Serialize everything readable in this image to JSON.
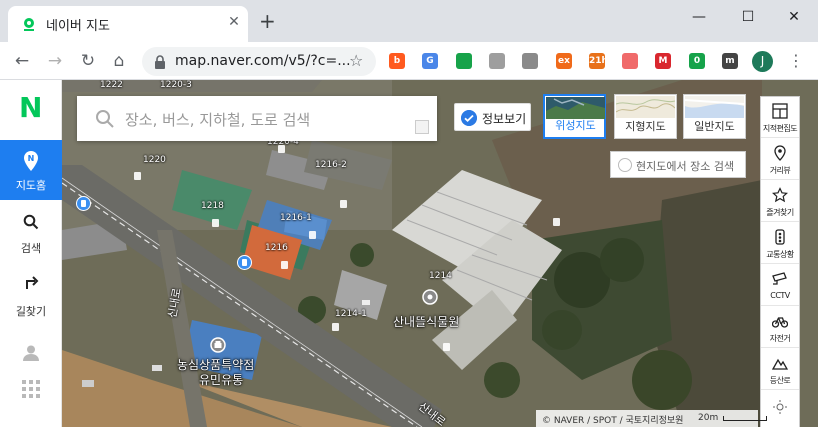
{
  "browser": {
    "tab_title": "네이버 지도",
    "tab_close": "✕",
    "new_tab": "+",
    "window_min": "—",
    "window_max": "☐",
    "window_close": "✕",
    "url": "map.naver.com/v5/?c=...",
    "profile_initial": "J",
    "extensions": [
      {
        "name": "b-icon",
        "color": "#ff5a1f",
        "text": "b"
      },
      {
        "name": "translate-icon",
        "color": "#4a86e8",
        "text": "G"
      },
      {
        "name": "screenshot-icon",
        "color": "#17a34a",
        "text": ""
      },
      {
        "name": "tag-icon",
        "color": "#9e9e9e",
        "text": ""
      },
      {
        "name": "dropbox-icon",
        "color": "#8a8a8a",
        "text": ""
      },
      {
        "name": "ex-icon",
        "color": "#f06a1a",
        "text": "ex"
      },
      {
        "name": "calendar-icon",
        "color": "#e8711a",
        "text": "21h"
      },
      {
        "name": "asana-icon",
        "color": "#f06a6a",
        "text": ""
      },
      {
        "name": "mega-icon",
        "color": "#d9272e",
        "text": "M"
      },
      {
        "name": "shield-check-icon",
        "color": "#16a34a",
        "text": "0"
      },
      {
        "name": "m-icon",
        "color": "#444444",
        "text": "m"
      }
    ]
  },
  "sidebar": {
    "logo": "N",
    "items": [
      {
        "label": "지도홈"
      },
      {
        "label": "검색"
      },
      {
        "label": "길찾기"
      }
    ]
  },
  "search": {
    "placeholder": "장소, 버스, 지하철, 도로 검색"
  },
  "info_toggle": "정보보기",
  "map_types": [
    {
      "label": "위성지도"
    },
    {
      "label": "지형지도"
    },
    {
      "label": "일반지도"
    }
  ],
  "area_search": "현지도에서 장소 검색",
  "right_tools": [
    {
      "label": "지적편집도",
      "icon": "cadastral-icon"
    },
    {
      "label": "거리뷰",
      "icon": "streetview-icon"
    },
    {
      "label": "즐겨찾기",
      "icon": "star-icon"
    },
    {
      "label": "교통상황",
      "icon": "traffic-icon"
    },
    {
      "label": "CCTV",
      "icon": "cctv-icon"
    },
    {
      "label": "자전거",
      "icon": "bicycle-icon"
    },
    {
      "label": "등산로",
      "icon": "mountain-icon"
    }
  ],
  "building_labels": [
    "1222",
    "1220-3",
    "1220-4",
    "1220",
    "1216-2",
    "1218",
    "1216-1",
    "1216",
    "1214",
    "1214-1"
  ],
  "poi": {
    "flower_market": "산내뜰식물원",
    "pharmacy_line1": "농심상품특약점",
    "pharmacy_line2": "유민유통"
  },
  "road_labels": [
    "신내로",
    "산내로"
  ],
  "copyright": "© NAVER / SPOT / 국토지리정보원",
  "scale": "20m"
}
